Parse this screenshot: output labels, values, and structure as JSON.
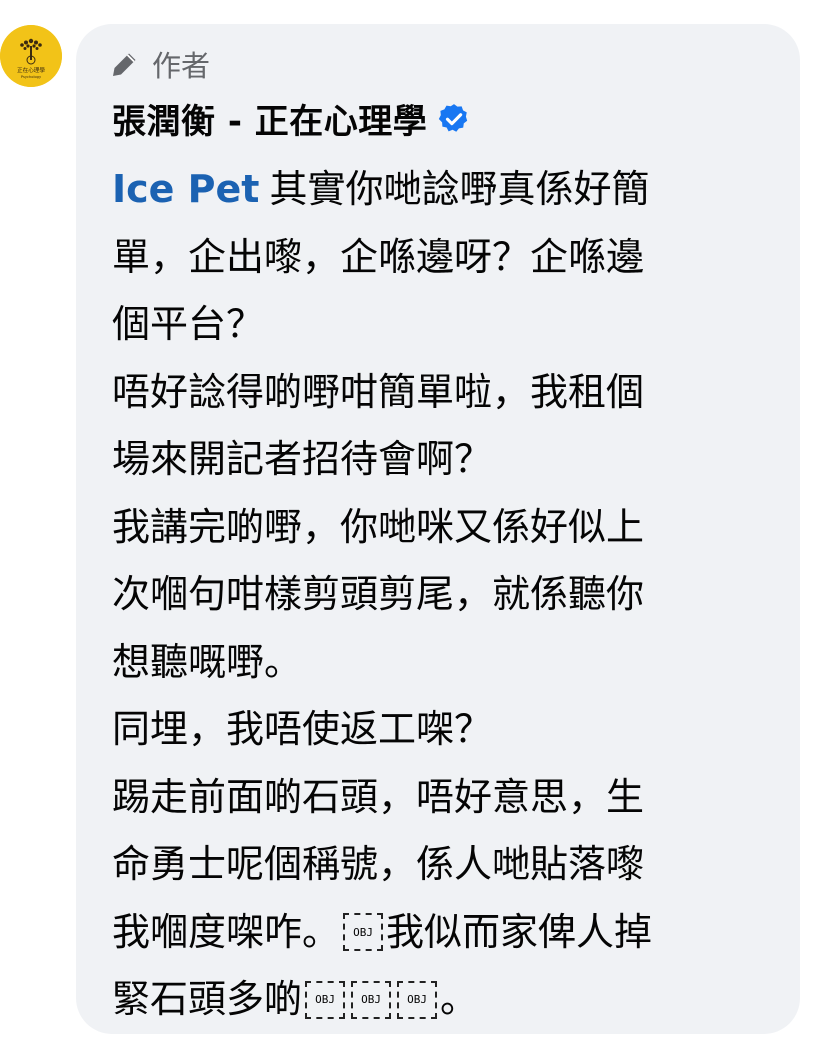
{
  "avatar": {
    "icon": "tree-logo-icon",
    "text": "正在心理學",
    "subtext": "Psychology",
    "background": "#f2c318"
  },
  "header": {
    "role_icon": "pencil-icon",
    "role_label": "作者",
    "author_name": "張潤衡 - 正在心理學",
    "verified_icon": "verified-badge-icon",
    "verified_color": "#1877f2"
  },
  "comment": {
    "mention": "Ice Pet",
    "mention_color": "#1b62b2",
    "lines": [
      "其實你哋諗嘢真係好簡",
      "單，企出嚟，企喺邊呀？企喺邊",
      "個平台？",
      "唔好諗得啲嘢咁簡單啦，我租個",
      "場來開記者招待會啊？",
      "我講完啲嘢，你哋咪又係好似上",
      "次嗰句咁樣剪頭剪尾，就係聽你",
      "想聽嘅嘢。",
      "同埋，我唔使返工㗎？",
      "踢走前面啲石頭，唔好意思，生",
      "命勇士呢個稱號，係人哋貼落嚟",
      "我嗰度㗎咋。",
      "我似而家俾人掉",
      "緊石頭多啲",
      "。"
    ],
    "obj_placeholder": "OBJ"
  }
}
